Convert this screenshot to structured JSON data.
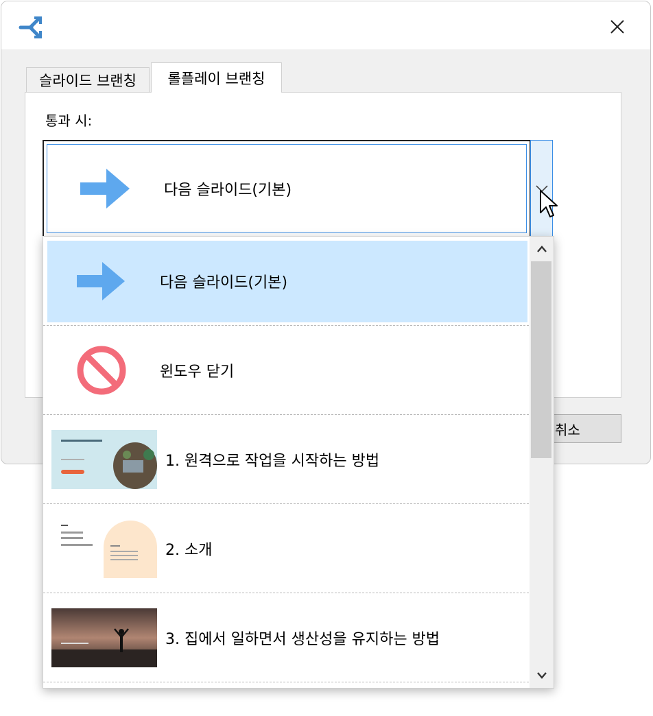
{
  "tabs": [
    {
      "label": "슬라이드 브랜칭"
    },
    {
      "label": "롤플레이 브랜칭"
    }
  ],
  "panel": {
    "pass_label": "통과 시:"
  },
  "combo": {
    "selected_label": "다음 슬라이드(기본)",
    "selected_icon": "arrow-right-icon"
  },
  "cancel_label": "취소",
  "dropdown": {
    "items": [
      {
        "label": "다음 슬라이드(기본)",
        "icon": "arrow-right-icon",
        "selected": true
      },
      {
        "label": "윈도우 닫기",
        "icon": "no-entry-icon",
        "selected": false
      },
      {
        "label": "1. 원격으로 작업을 시작하는 방법",
        "thumbnail": "slide-thumbnail",
        "selected": false
      },
      {
        "label": "2. 소개",
        "thumbnail": "slide-thumbnail",
        "selected": false
      },
      {
        "label": "3. 집에서 일하면서 생산성을 유지하는 방법",
        "thumbnail": "slide-thumbnail",
        "selected": false
      }
    ],
    "scroll_fraction": 0.49
  },
  "colors": {
    "accent": "#3a8ee6",
    "selection": "#cce8ff",
    "arrow": "#5ea8ee",
    "no_entry": "#f36c7a"
  }
}
